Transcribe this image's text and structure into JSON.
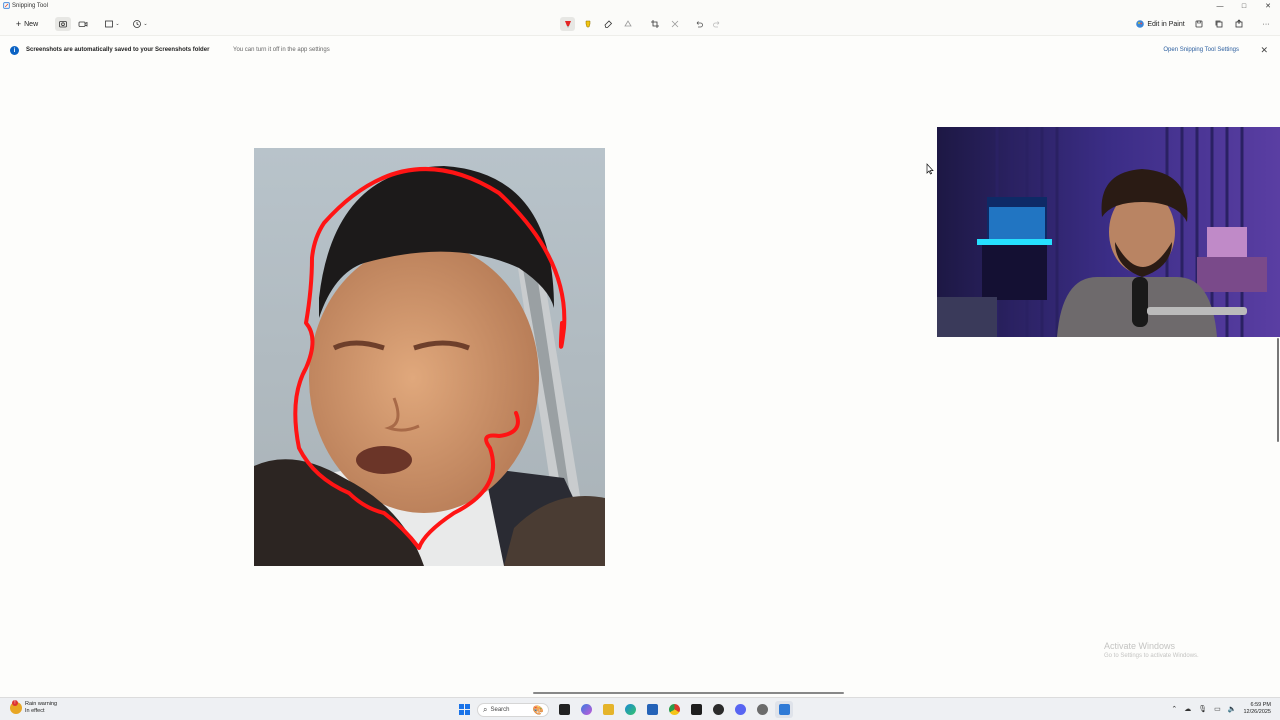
{
  "window": {
    "title": "Snipping Tool",
    "controls": [
      "—",
      "□",
      "✕"
    ]
  },
  "toolbar": {
    "new_label": "New",
    "edit_in_paint": "Edit in Paint",
    "more": "···"
  },
  "infobar": {
    "message": "Screenshots are automatically saved to your Screenshots folder",
    "sub": "You can turn it off in the app settings",
    "link": "Open Snipping Tool Settings",
    "close": "✕"
  },
  "watermark": {
    "line1": "Activate Windows",
    "line2": "Go to Settings to activate Windows."
  },
  "taskbar": {
    "weather_line1": "Rain warning",
    "weather_line2": "In effect",
    "search_placeholder": "Search",
    "time": "6:59 PM",
    "date": "12/26/2025",
    "apps": [
      {
        "name": "start-icon",
        "color": "#1a73e8"
      },
      {
        "name": "file-explorer-icon",
        "color": "#222222"
      },
      {
        "name": "copilot-icon",
        "color": "#3a7be0"
      },
      {
        "name": "folder-icon",
        "color": "#e5b42a"
      },
      {
        "name": "edge-icon",
        "color": "#1b8ad3"
      },
      {
        "name": "store-icon",
        "color": "#2563b8"
      },
      {
        "name": "chrome-icon",
        "color": "#d9392b"
      },
      {
        "name": "terminal-icon",
        "color": "#1e1e1e"
      },
      {
        "name": "app-icon",
        "color": "#2b2b2b"
      },
      {
        "name": "discord-icon",
        "color": "#5865f2"
      },
      {
        "name": "settings-icon",
        "color": "#6b6b6b"
      },
      {
        "name": "snipping-tool-icon",
        "color": "#2f7ad6"
      }
    ]
  },
  "colors": {
    "accent": "#0b63c4",
    "annotation": "#ff1414"
  }
}
